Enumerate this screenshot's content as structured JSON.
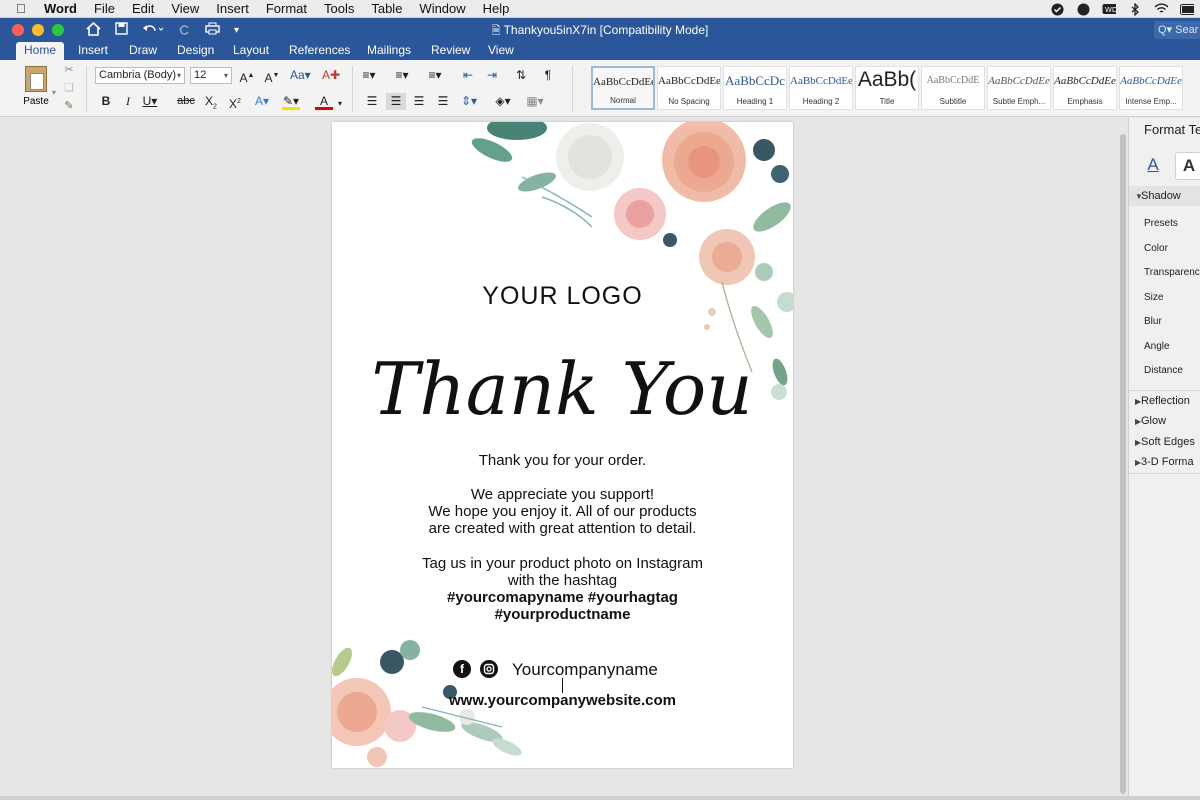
{
  "menubar": {
    "app_name": "Word",
    "items": [
      "File",
      "Edit",
      "View",
      "Insert",
      "Format",
      "Tools",
      "Table",
      "Window",
      "Help"
    ]
  },
  "titlebar": {
    "document_title": "Thankyou5inX7in [Compatibility Mode]",
    "search_placeholder": "Q▾ Sear"
  },
  "tabs": [
    "Home",
    "Insert",
    "Draw",
    "Design",
    "Layout",
    "References",
    "Mailings",
    "Review",
    "View"
  ],
  "ribbon": {
    "paste_label": "Paste",
    "font_name": "Cambria (Body)",
    "font_size": "12",
    "styles": [
      {
        "sample": "AaBbCcDdEe",
        "name": "Normal"
      },
      {
        "sample": "AaBbCcDdEe",
        "name": "No Spacing"
      },
      {
        "sample": "AaBbCcDc",
        "name": "Heading 1"
      },
      {
        "sample": "AaBbCcDdEe",
        "name": "Heading 2"
      },
      {
        "sample": "AaBb(",
        "name": "Title"
      },
      {
        "sample": "AaBbCcDdE",
        "name": "Subtitle"
      },
      {
        "sample": "AaBbCcDdEe",
        "name": "Subtle Emph..."
      },
      {
        "sample": "AaBbCcDdEe",
        "name": "Emphasis"
      },
      {
        "sample": "AaBbCcDdEe",
        "name": "Intense Emp..."
      }
    ]
  },
  "document": {
    "logo": "YOUR LOGO",
    "thank_you": "Thank You",
    "line1": "Thank you for your order.",
    "para2": [
      "We appreciate you support!",
      "We hope you enjoy it. All of our products",
      "are created with great attention to detail."
    ],
    "para3": [
      "Tag us in your product photo on Instagram",
      "with the hashtag"
    ],
    "hashtags": [
      "#yourcomapyname #yourhagtag",
      "#yourproductname"
    ],
    "company": "Yourcompanyname",
    "website": "www.yourcompanywebsite.com"
  },
  "format_panel": {
    "title": "Format Te",
    "shadow": "Shadow",
    "props": [
      "Presets",
      "Color",
      "Transparency",
      "Size",
      "Blur",
      "Angle",
      "Distance"
    ],
    "sections": [
      "Reflection",
      "Glow",
      "Soft Edges",
      "3-D Forma"
    ]
  },
  "colors": {
    "word_blue": "#2b579a"
  }
}
